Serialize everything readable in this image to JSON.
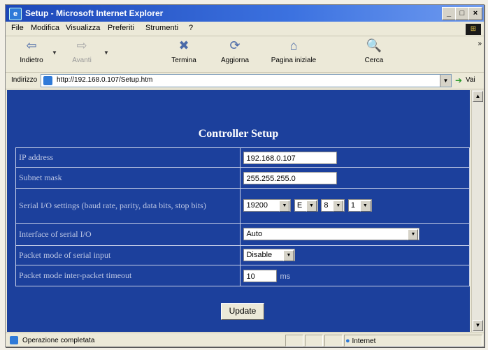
{
  "window": {
    "title": "Setup - Microsoft Internet Explorer",
    "controls": [
      "_",
      "□",
      "×"
    ]
  },
  "menu": {
    "items": [
      "File",
      "Modifica",
      "Visualizza",
      "Preferiti",
      "Strumenti",
      "?"
    ]
  },
  "toolbar": {
    "back": "Indietro",
    "forward": "Avanti",
    "stop": "Termina",
    "refresh": "Aggiorna",
    "home": "Pagina iniziale",
    "search": "Cerca"
  },
  "address": {
    "label": "Indirizzo",
    "url": "http://192.168.0.107/Setup.htm",
    "go": "Vai"
  },
  "page": {
    "title": "Controller Setup",
    "rows": [
      {
        "label": "IP address",
        "value": "192.168.0.107"
      },
      {
        "label": "Subnet mask",
        "value": "255.255.255.0"
      },
      {
        "label": "Serial I/O settings (baud rate, parity, data bits, stop bits)",
        "baud": "19200",
        "parity": "E",
        "data_bits": "8",
        "stop_bits": "1"
      },
      {
        "label": "Interface of serial I/O",
        "value": "Auto"
      },
      {
        "label": "Packet mode of serial input",
        "value": "Disable"
      },
      {
        "label": "Packet mode inter-packet timeout",
        "value": "10",
        "unit": "ms"
      }
    ],
    "update_button": "Update"
  },
  "status": {
    "text": "Operazione completata",
    "zone": "Internet"
  }
}
